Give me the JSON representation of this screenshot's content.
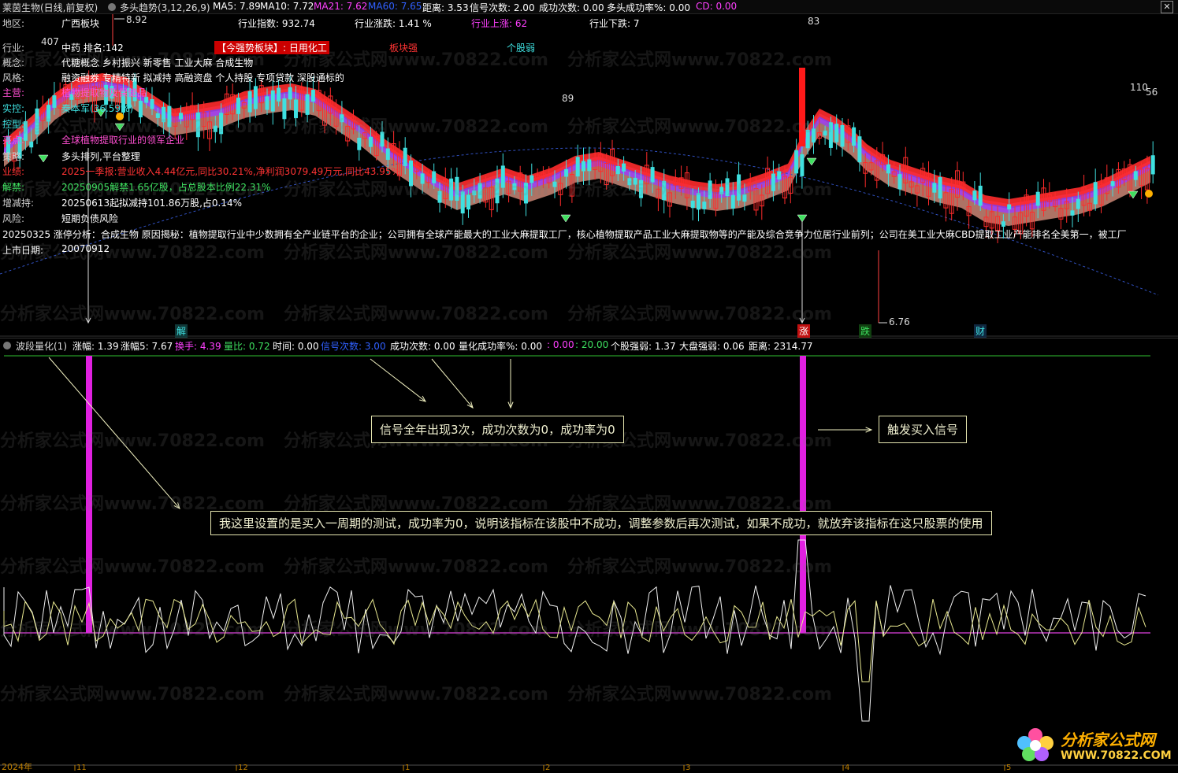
{
  "title_bar": {
    "stock": "莱茵生物(日线,前复权)",
    "indicator": "多头趋势(3,12,26,9)",
    "ma5": "MA5: 7.89",
    "ma10": "MA10: 7.72",
    "ma21": "MA21: 7.62",
    "ma60": "MA60: 7.65",
    "distance": "距离: 3.53",
    "signal_count": "信号次数: 2.00",
    "success_count": "成功次数: 0.00",
    "success_rate": "多头成功率%: 0.00",
    "cd": "CD: 0.00"
  },
  "row2": {
    "region_label": "地区:",
    "region_value": "广西板块",
    "industry_index": "行业指数: 932.74",
    "industry_change": "行业涨跌: 1.41 %",
    "industry_up": "行业上涨: 62",
    "industry_down": "行业下跌: 7"
  },
  "info_panel": [
    {
      "label": "行业:",
      "value": "中药 排名:142",
      "lc": "#d0d0d0",
      "vc": "#ffffff"
    },
    {
      "label": "概念:",
      "value": "代糖概念 乡村振兴 新零售 工业大麻 合成生物",
      "lc": "#d0d0d0",
      "vc": "#ffffff"
    },
    {
      "label": "风格:",
      "value": "融资融券 专精特新 拟减持 高融资盘 个人持股 专项贷款 深股通标的",
      "lc": "#d0d0d0",
      "vc": "#ffffff"
    },
    {
      "label": "主营:",
      "value": "植物提取物及保健品",
      "lc": "#ff4fd2",
      "vc": "#ff4fd2"
    },
    {
      "label": "实控:",
      "value": "秦本军(36.59%)",
      "lc": "#3ee0e0",
      "vc": "#3ee0e0"
    },
    {
      "label": "控型:",
      "value": "",
      "lc": "#3ee0e0",
      "vc": "#3ee0e0"
    },
    {
      "label": "亮点:",
      "value": "全球植物提取行业的领军企业",
      "lc": "#ff4fd2",
      "vc": "#ff4fd2"
    },
    {
      "label": "策略:",
      "value": "多头排列,平台整理",
      "lc": "#d0d0d0",
      "vc": "#ffffff"
    },
    {
      "label": "业绩:",
      "value": "2025一季报:营业收入4.44亿元,同比30.21%,净利润3079.49万元,同比43.95%",
      "lc": "#ff3333",
      "vc": "#ff3333"
    },
    {
      "label": "解禁:",
      "value": "20250905解禁1.65亿股，占总股本比例22.31%",
      "lc": "#3ee060",
      "vc": "#3ee060"
    },
    {
      "label": "增减持:",
      "value": "20250613起拟减持101.86万股,占0.14%",
      "lc": "#d0d0d0",
      "vc": "#ffffff"
    },
    {
      "label": "风险:",
      "value": "短期负债风险",
      "lc": "#d0d0d0",
      "vc": "#ffffff"
    }
  ],
  "limit_up_note": "20250325 涨停分析：合成生物 原因揭秘：植物提取行业中少数拥有全产业链平台的企业；公司拥有全球产能最大的工业大麻提取工厂，核心植物提取产品工业大麻提取物等的产能及综合竞争力位居行业前列；公司在美工业大麻CBD提取工业产能排名全美第一，被工厂",
  "listing": {
    "label": "上市日期:",
    "value": "20070912"
  },
  "tags": {
    "strong_sector": "【今强势板块】: 日用化工",
    "sector_strong": "板块强",
    "stock_weak": "个股弱"
  },
  "price_marks": {
    "high_left": "8.92",
    "num407": "407",
    "num89": "89",
    "num83": "83",
    "num110": "110",
    "num56": "56",
    "low": "6.76"
  },
  "event_marks": {
    "jie": "解",
    "zhang": "涨",
    "die": "跌",
    "cai": "财"
  },
  "sub_header": {
    "name": "波段量化(1)",
    "amp": "涨幅: 1.39",
    "amp5": "涨幅5: 7.67",
    "turnover": "换手: 4.39",
    "vol_ratio": "量比: 0.72",
    "time": "时间: 0.00",
    "signal_count": "信号次数: 3.00",
    "success_count": "成功次数: 0.00",
    "rate": "量化成功率%: 0.00",
    "v1": ": 0.00",
    "v2": ": 20.00",
    "stock_strength": "个股强弱: 1.37",
    "market_strength": "大盘强弱: 0.06",
    "distance": "距离: 2314.77"
  },
  "callouts": {
    "signal_text": "信号全年出现3次，成功次数为0，成功率为0",
    "trigger_text": "触发买入信号",
    "note_text": "我这里设置的是买入一周期的测试，成功率为0，说明该指标在该股中不成功，调整参数后再次测试，如果不成功，就放弃该指标在这只股票的使用"
  },
  "watermark": "分析家公式网www.70822.com",
  "logo": {
    "name": "分析家公式网",
    "url": "WWW.70822.COM"
  },
  "bottom_axis": [
    "2024年",
    "11",
    "12",
    "1",
    "2",
    "3",
    "4",
    "5"
  ],
  "colors": {
    "up": "#ff2b2b",
    "down": "#3fe0e0",
    "ribbon_pink": "#f4a0a0",
    "ribbon_purple": "#a040f0",
    "ribbon_tan": "#c08070",
    "signal_bar": "#e020e0",
    "zero_line": "#e040e0"
  }
}
